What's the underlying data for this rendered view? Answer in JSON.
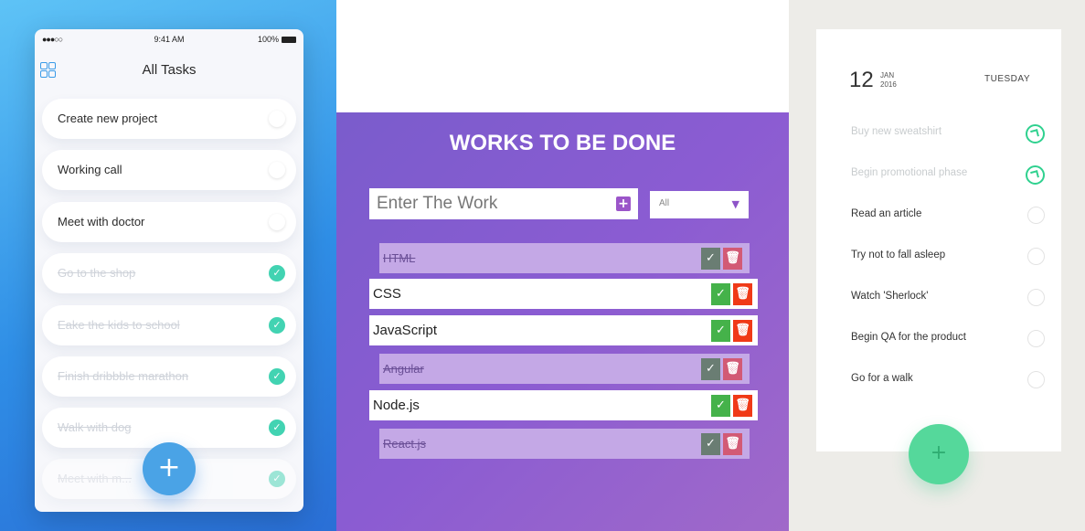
{
  "panel1": {
    "status": {
      "signal": "●●●○○",
      "time": "9:41 AM",
      "battery": "100%"
    },
    "title": "All Tasks",
    "tasks": [
      {
        "label": "Create new project",
        "done": false
      },
      {
        "label": "Working call",
        "done": false
      },
      {
        "label": "Meet with doctor",
        "done": false
      },
      {
        "label": "Go to the shop",
        "done": true
      },
      {
        "label": "Eake the kids to school",
        "done": true
      },
      {
        "label": "Finish dribbble marathon",
        "done": true
      },
      {
        "label": "Walk with dog",
        "done": true
      },
      {
        "label": "Meet with m...",
        "done": true
      }
    ],
    "fab": "+",
    "colors": {
      "accent": "#4aa3e6",
      "done": "#42d3b2"
    }
  },
  "panel2": {
    "heading": "WORKS TO BE DONE",
    "input_placeholder": "Enter The Work",
    "add": "+",
    "filter_value": "All",
    "filter_arrow": "▼",
    "rows": [
      {
        "label": "HTML",
        "done": true
      },
      {
        "label": "CSS",
        "done": false
      },
      {
        "label": "JavaScript",
        "done": false
      },
      {
        "label": "Angular",
        "done": true
      },
      {
        "label": "Node.js",
        "done": false
      },
      {
        "label": "React.js",
        "done": true
      }
    ],
    "check": "✓",
    "trash": "🗑",
    "colors": {
      "check": "#45b24a",
      "delete": "#f03a17"
    }
  },
  "panel3": {
    "day": "12",
    "month": "JAN",
    "year": "2016",
    "weekday": "TUESDAY",
    "items": [
      {
        "label": "Buy new sweatshirt",
        "done": true
      },
      {
        "label": "Begin promotional phase",
        "done": true
      },
      {
        "label": "Read an article",
        "done": false
      },
      {
        "label": "Try not to fall asleep",
        "done": false
      },
      {
        "label": "Watch 'Sherlock'",
        "done": false
      },
      {
        "label": "Begin QA for the product",
        "done": false
      },
      {
        "label": "Go for a walk",
        "done": false
      }
    ],
    "fab": "+",
    "colors": {
      "accent": "#55d89b"
    }
  }
}
